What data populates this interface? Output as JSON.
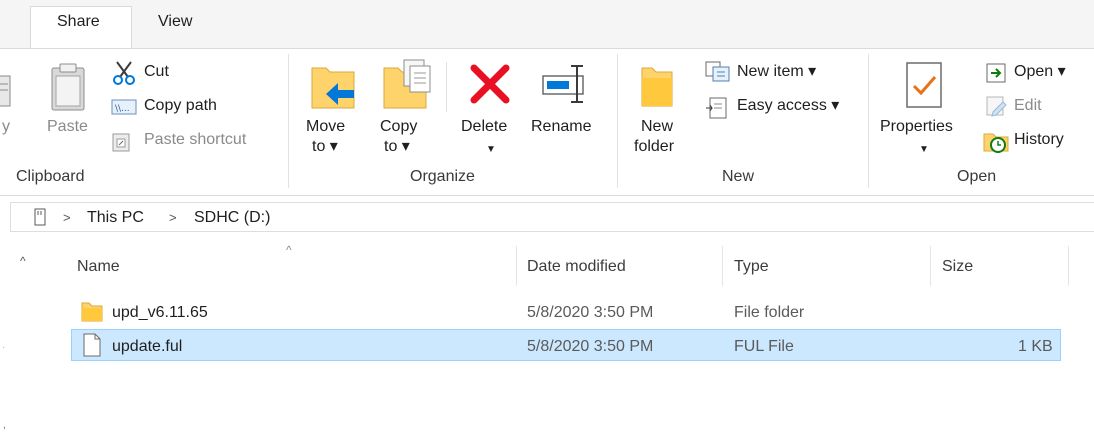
{
  "tabs": [
    {
      "label": "Share",
      "active": true
    },
    {
      "label": "View",
      "active": false
    }
  ],
  "ribbon": {
    "clipboard": {
      "partial_label": "y",
      "paste": "Paste",
      "cut": "Cut",
      "copy_path": "Copy path",
      "paste_shortcut": "Paste shortcut",
      "group_label": "Clipboard"
    },
    "organize": {
      "move_to": [
        "Move",
        "to ▾"
      ],
      "copy_to": [
        "Copy",
        "to ▾"
      ],
      "delete": "Delete",
      "rename": "Rename",
      "group_label": "Organize"
    },
    "new": {
      "new_folder": [
        "New",
        "folder"
      ],
      "new_item": "New item ▾",
      "easy_access": "Easy access ▾",
      "group_label": "New"
    },
    "open": {
      "properties": "Properties",
      "open": "Open ▾",
      "edit": "Edit",
      "history": "History",
      "group_label": "Open"
    }
  },
  "address": {
    "crumbs": [
      "This PC",
      "SDHC (D:)"
    ]
  },
  "columns": [
    "Name",
    "Date modified",
    "Type",
    "Size"
  ],
  "files": [
    {
      "name": "upd_v6.11.65",
      "date": "5/8/2020 3:50 PM",
      "type": "File folder",
      "size": "",
      "icon": "folder-icon",
      "selected": false
    },
    {
      "name": "update.ful",
      "date": "5/8/2020 3:50 PM",
      "type": "FUL File",
      "size": "1 KB",
      "icon": "file-icon",
      "selected": true
    }
  ],
  "colors": {
    "accent": "#0078d7",
    "selection": "#cce8ff",
    "selection_border": "#99d1ff",
    "folder": "#ffd36b",
    "delete": "#e81123"
  }
}
